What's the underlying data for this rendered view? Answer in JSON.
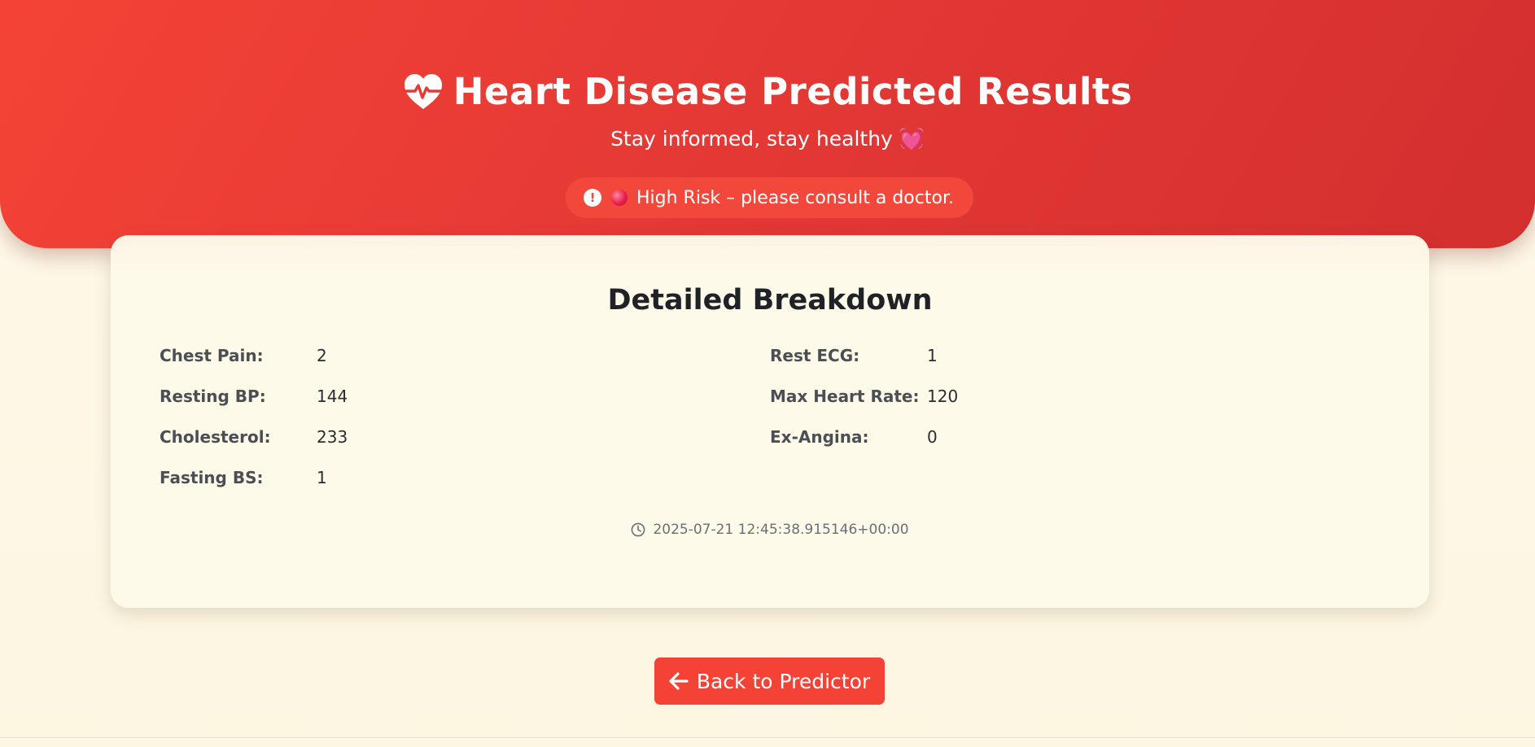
{
  "header": {
    "title": "Heart Disease Predicted Results",
    "subtitle": "Stay informed, stay healthy 💓",
    "heart_icon": "heart-pulse-icon",
    "accent_color": "#f44336"
  },
  "risk": {
    "alert_icon": "exclamation-circle-icon",
    "dot_icon": "red-circle-emoji",
    "message": "High Risk – please consult a doctor."
  },
  "breakdown": {
    "title": "Detailed Breakdown",
    "left": [
      {
        "label": "Chest Pain:",
        "value": "2"
      },
      {
        "label": "Resting BP:",
        "value": "144"
      },
      {
        "label": "Cholesterol:",
        "value": "233"
      },
      {
        "label": "Fasting BS:",
        "value": "1"
      }
    ],
    "right": [
      {
        "label": "Rest ECG:",
        "value": "1"
      },
      {
        "label": "Max Heart Rate:",
        "value": "120"
      },
      {
        "label": "Ex-Angina:",
        "value": "0"
      }
    ],
    "timestamp": "2025-07-21 12:45:38.915146+00:00",
    "clock_icon": "clock-icon"
  },
  "actions": {
    "back_label": "Back to Predictor",
    "back_icon": "arrow-left-icon"
  }
}
